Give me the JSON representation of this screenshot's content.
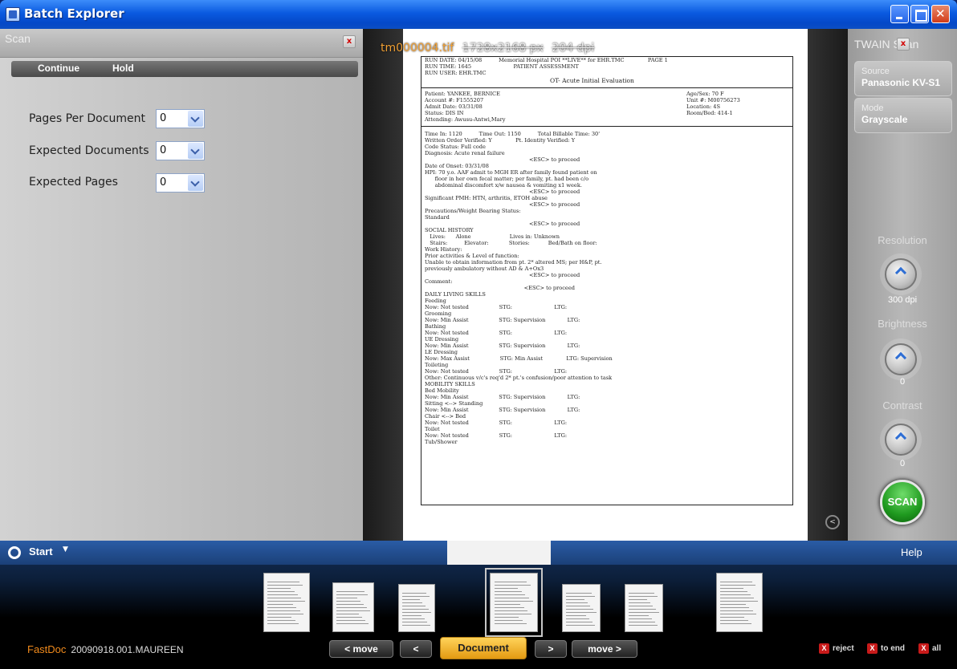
{
  "window": {
    "title": "Batch Explorer"
  },
  "scan_panel": {
    "title": "Scan",
    "close": "x",
    "continue_label": "Continue",
    "hold_label": "Hold",
    "fields": [
      {
        "label": "Pages Per Document",
        "value": "0"
      },
      {
        "label": "Expected Documents",
        "value": "0"
      },
      {
        "label": "Expected Pages",
        "value": "0"
      }
    ]
  },
  "viewer": {
    "file_name": "tm000004.tif",
    "dimensions": "1728x2168 px",
    "dpi": "204 dpi",
    "back_icon": "<",
    "document": {
      "header_lines": [
        "RUN DATE: 04/15/08          Memorial Hospital POI **LIVE** for EHR.TMC              PAGE 1",
        "RUN TIME: 1645                         PATIENT ASSESSMENT",
        "RUN USER: EHR.TMC"
      ],
      "subtitle": "OT- Acute Initial Evaluation",
      "patient_left": [
        "Patient: YANKEE, BERNICE",
        "Account #: F1555207",
        "Admit Date: 03/31/08",
        "Status: DIS IN",
        "Attending: Awusu-Antwi,Mary"
      ],
      "patient_right": [
        "Age/Sex: 70 F",
        "Unit #: M00756273",
        "Location: 4S",
        "Room/Bed: 414-1"
      ],
      "body_lines": [
        "Time In: 1120          Time Out: 1150          Total Billable Time: 30'",
        "Written Order Verified: Y              Pt. Identity Verified: Y",
        "Code Status: Full code",
        "Diagnosis: Acute renal failure",
        "                                                              <ESC> to proceed",
        "Date of Onset: 03/31/08",
        "HPI: 70 y.o. AAF admit to MGH ER after family found patient on",
        "      floor in her own fecal matter; per family, pt. had been c/o",
        "      abdominal discomfort x/w nausea & vomiting x1 week.",
        "                                                              <ESC> to proceed",
        "Significant PMH: HTN, arthritis, ETOH abuse",
        "                                                              <ESC> to proceed",
        "Precautions/Weight Bearing Status:",
        "Standard",
        "                                                              <ESC> to proceed",
        "SOCIAL HISTORY",
        "   Lives:      Alone                       Lives in: Unknown",
        "   Stairs:          Elevator:            Stories:           Bed/Bath on floor:",
        "Work History:",
        "Prior activities & Level of function:",
        "Unable to obtain information from pt. 2* altered MS; per H&P, pt.",
        "previously ambulatory without AD & A+Ox3",
        "                                                              <ESC> to proceed",
        "Comment:",
        "                                                           <ESC> to proceed",
        "DAILY LIVING SKILLS",
        "Feeding",
        "Now: Not tested                  STG:                         LTG:",
        "Grooming",
        "Now: Min Assist                  STG: Supervision             LTG:",
        "Bathing",
        "Now: Not tested                  STG:                         LTG:",
        "UE Dressing",
        "Now: Min Assist                  STG: Supervision             LTG:",
        "LE Dressing",
        "Now: Max Assist                  STG: Min Assist              LTG: Supervision",
        "Toileting",
        "Now: Not tested                  STG:                         LTG:",
        "Other: Continuous v/c's req'd 2* pt.'s confusion/poor attention to task",
        "MOBILITY SKILLS",
        "Bed Mobility",
        "Now: Min Assist                  STG: Supervision             LTG:",
        "Sitting <--> Standing",
        "Now: Min Assist                  STG: Supervision             LTG:",
        "Chair <--> Bed",
        "Now: Not tested                  STG:                         LTG:",
        "Toilet",
        "Now: Not tested                  STG:                         LTG:",
        "Tub/Shower"
      ]
    }
  },
  "twain_panel": {
    "title": "TWAIN Scan",
    "close": "x",
    "source_label": "Source",
    "source_value": "Panasonic KV-S1",
    "mode_label": "Mode",
    "mode_value": "Grayscale",
    "resolution_label": "Resolution",
    "resolution_value": "300 dpi",
    "brightness_label": "Brightness",
    "brightness_value": "0",
    "contrast_label": "Contrast",
    "contrast_value": "0",
    "scan_label": "SCAN"
  },
  "bottom_bar": {
    "start_label": "Start",
    "help_label": "Help",
    "brand": "FastDoc",
    "batch_name": "20090918.001.MAUREEN",
    "move_back_label": "< move",
    "prev_label": "<",
    "document_label": "Document",
    "next_label": ">",
    "move_forward_label": "move >",
    "reject_label": "reject",
    "to_end_label": "to end",
    "all_label": "all"
  }
}
